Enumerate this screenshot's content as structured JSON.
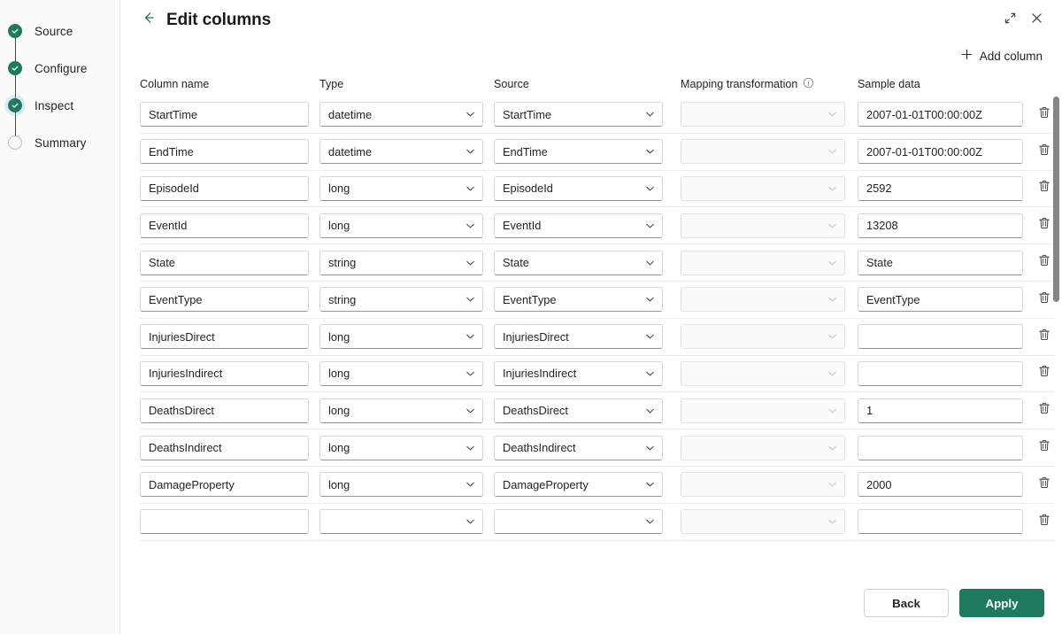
{
  "sidebar": {
    "steps": [
      {
        "label": "Source",
        "state": "done"
      },
      {
        "label": "Configure",
        "state": "done"
      },
      {
        "label": "Inspect",
        "state": "done-current"
      },
      {
        "label": "Summary",
        "state": "todo"
      }
    ]
  },
  "header": {
    "title": "Edit columns",
    "back_icon": "arrow-left-icon",
    "expand_icon": "expand-icon",
    "close_icon": "close-icon"
  },
  "toolbar": {
    "add_column_label": "Add column",
    "add_icon": "plus-icon"
  },
  "grid": {
    "headers": {
      "column_name": "Column name",
      "type": "Type",
      "source": "Source",
      "mapping_transformation": "Mapping transformation",
      "mapping_info_icon": "info-icon",
      "sample_data": "Sample data"
    },
    "delete_icon": "trash-icon",
    "chevron_icon": "chevron-down-icon",
    "rows": [
      {
        "name": "StartTime",
        "type": "datetime",
        "source": "StartTime",
        "mapping": "",
        "sample": "2007-01-01T00:00:00Z"
      },
      {
        "name": "EndTime",
        "type": "datetime",
        "source": "EndTime",
        "mapping": "",
        "sample": "2007-01-01T00:00:00Z"
      },
      {
        "name": "EpisodeId",
        "type": "long",
        "source": "EpisodeId",
        "mapping": "",
        "sample": "2592"
      },
      {
        "name": "EventId",
        "type": "long",
        "source": "EventId",
        "mapping": "",
        "sample": "13208"
      },
      {
        "name": "State",
        "type": "string",
        "source": "State",
        "mapping": "",
        "sample": "State"
      },
      {
        "name": "EventType",
        "type": "string",
        "source": "EventType",
        "mapping": "",
        "sample": "EventType"
      },
      {
        "name": "InjuriesDirect",
        "type": "long",
        "source": "InjuriesDirect",
        "mapping": "",
        "sample": ""
      },
      {
        "name": "InjuriesIndirect",
        "type": "long",
        "source": "InjuriesIndirect",
        "mapping": "",
        "sample": ""
      },
      {
        "name": "DeathsDirect",
        "type": "long",
        "source": "DeathsDirect",
        "mapping": "",
        "sample": "1"
      },
      {
        "name": "DeathsIndirect",
        "type": "long",
        "source": "DeathsIndirect",
        "mapping": "",
        "sample": ""
      },
      {
        "name": "DamageProperty",
        "type": "long",
        "source": "DamageProperty",
        "mapping": "",
        "sample": "2000"
      },
      {
        "name": "",
        "type": "",
        "source": "",
        "mapping": "",
        "sample": ""
      }
    ]
  },
  "footer": {
    "back_label": "Back",
    "apply_label": "Apply"
  },
  "colors": {
    "accent_green": "#1d7a5f",
    "sidebar_bg": "#fafafa",
    "border": "#d6d6d6"
  }
}
